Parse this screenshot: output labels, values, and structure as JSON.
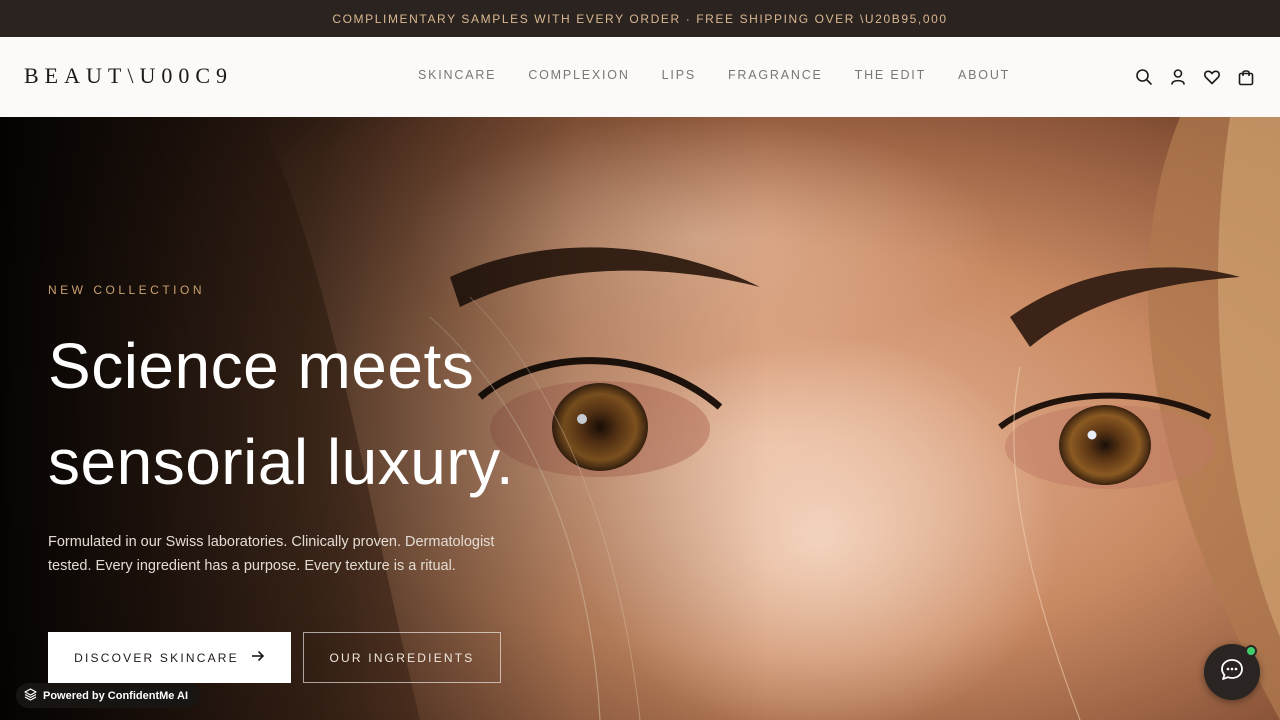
{
  "announcement": "COMPLIMENTARY SAMPLES WITH EVERY ORDER · FREE SHIPPING OVER \\U20B95,000",
  "header": {
    "logo": "BEAUT\\U00C9",
    "nav": [
      "SKINCARE",
      "COMPLEXION",
      "LIPS",
      "FRAGRANCE",
      "THE EDIT",
      "ABOUT"
    ],
    "icons": [
      "search-icon",
      "account-icon",
      "wishlist-icon",
      "bag-icon"
    ]
  },
  "hero": {
    "eyebrow": "NEW COLLECTION",
    "headline_line1": "Science meets",
    "headline_line2": "sensorial luxury.",
    "body": "Formulated in our Swiss laboratories. Clinically proven. Dermatologist tested. Every ingredient has a purpose. Every texture is a ritual.",
    "primary_cta": "DISCOVER SKINCARE",
    "secondary_cta": "OUR INGREDIENTS"
  },
  "widgets": {
    "powered_by": "Powered by ConfidentMe AI",
    "chat_status": "online"
  },
  "colors": {
    "announcement_bg": "#2b2320",
    "accent_gold": "#c9a070",
    "header_bg": "#fbfaf8",
    "status_green": "#3fcf6a"
  }
}
